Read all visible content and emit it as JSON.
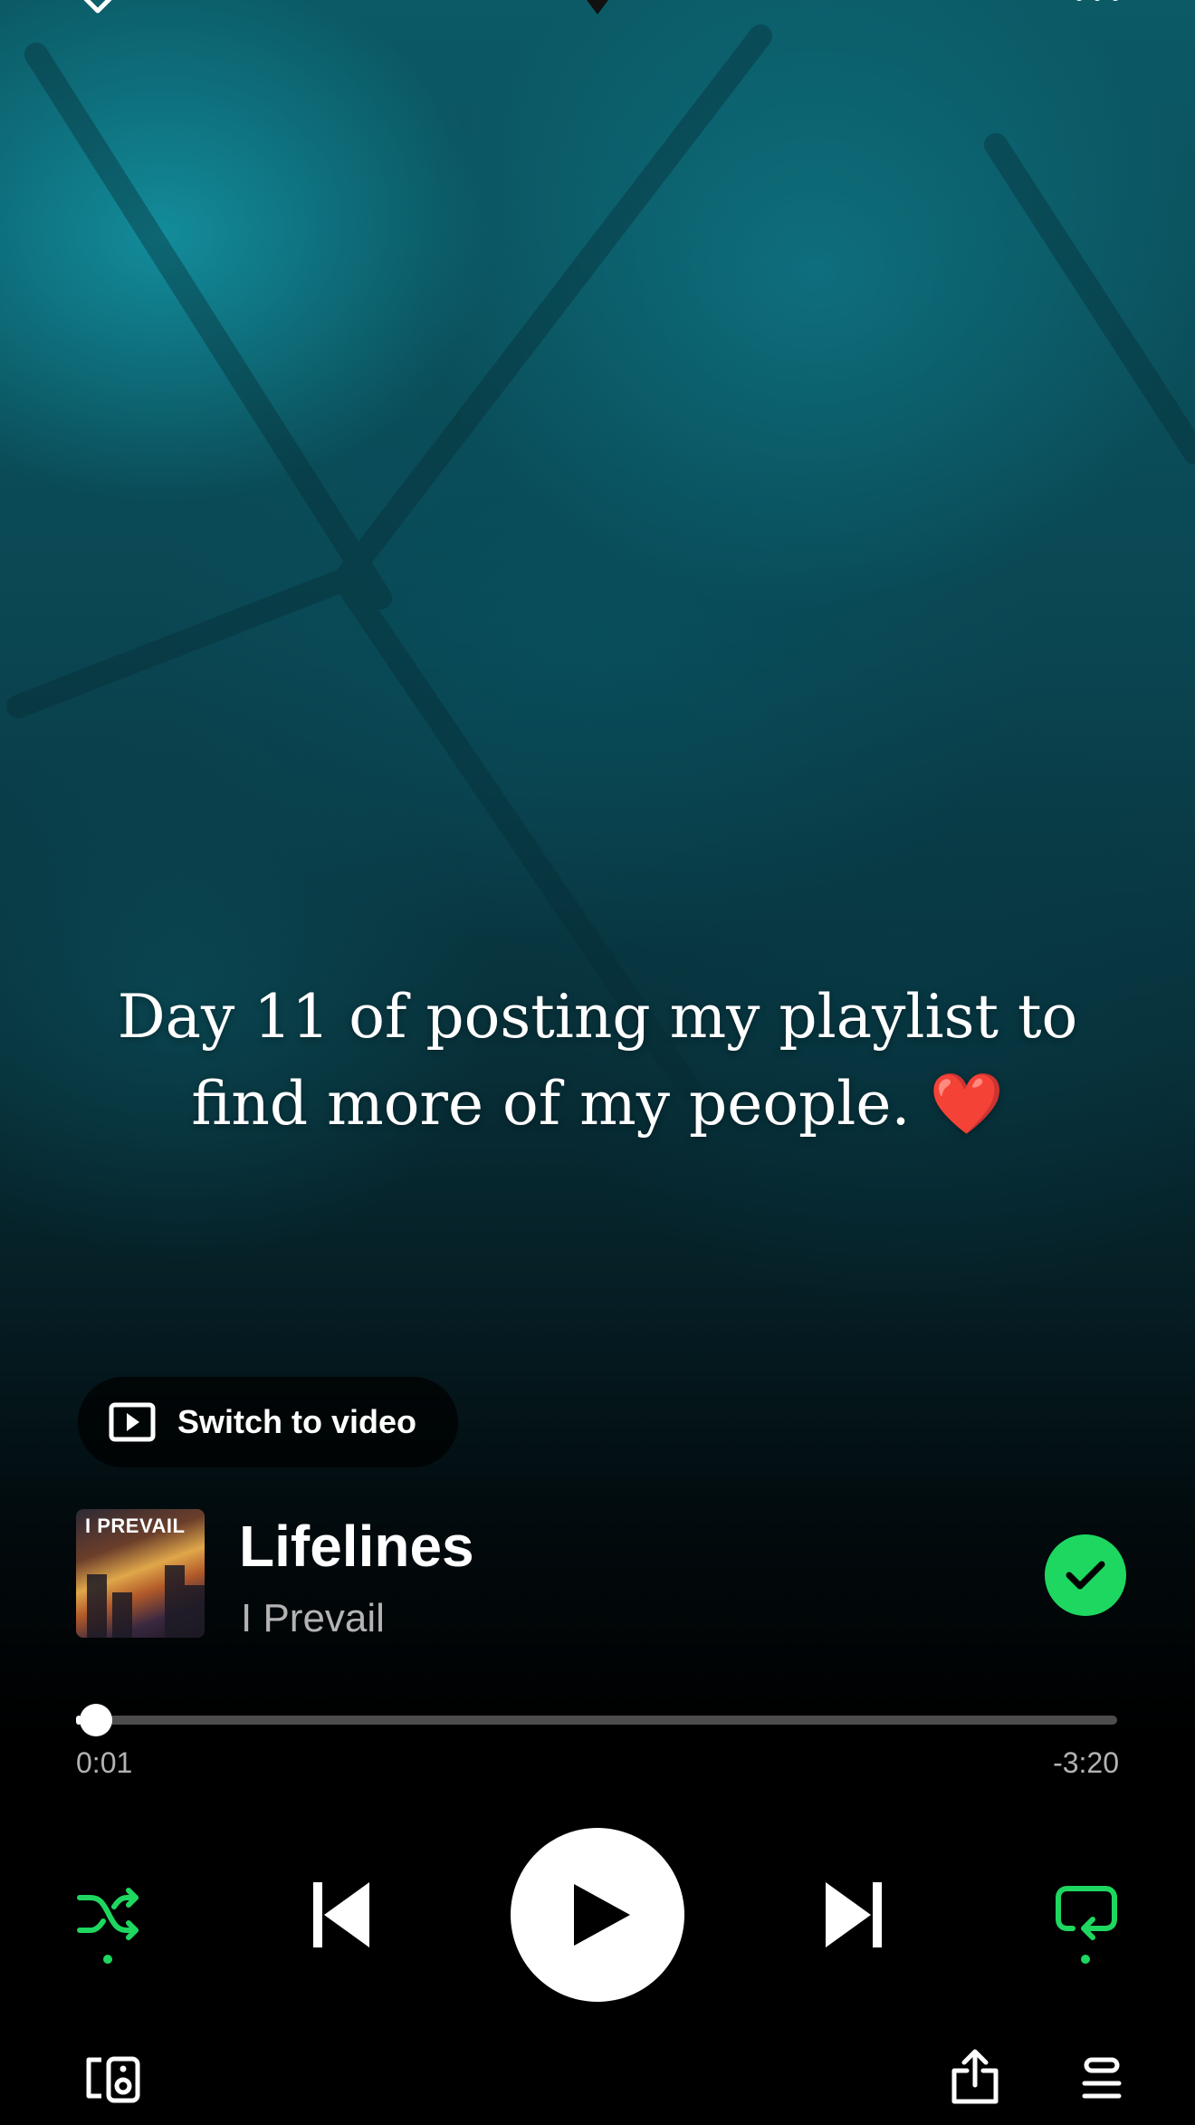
{
  "header": {
    "collapse_icon": "chevron-down-icon",
    "center_icon": "pin-icon",
    "more_icon": "more-horizontal-icon"
  },
  "canvas": {
    "caption": "Day 11 of posting my playlist to find more of my people.",
    "caption_emoji": "❤️"
  },
  "switch_video": {
    "label": "Switch to video",
    "icon": "video-icon"
  },
  "track": {
    "title": "Lifelines",
    "artist": "I Prevail",
    "album_art_text": "I PREVAIL",
    "saved": true,
    "saved_icon": "check-icon"
  },
  "playback": {
    "elapsed": "0:01",
    "remaining": "-3:20",
    "progress_fraction": 0.005
  },
  "controls": {
    "shuffle_active": true,
    "repeat_active": true,
    "shuffle_icon": "shuffle-icon",
    "previous_icon": "skip-back-icon",
    "play_icon": "play-icon",
    "next_icon": "skip-forward-icon",
    "repeat_icon": "repeat-icon"
  },
  "bottom_bar": {
    "devices_icon": "connect-device-icon",
    "share_icon": "share-icon",
    "queue_icon": "queue-icon"
  },
  "colors": {
    "accent": "#1ed760",
    "caption_heart": "#e01e2b",
    "secondary_text": "#b3b3b3"
  }
}
